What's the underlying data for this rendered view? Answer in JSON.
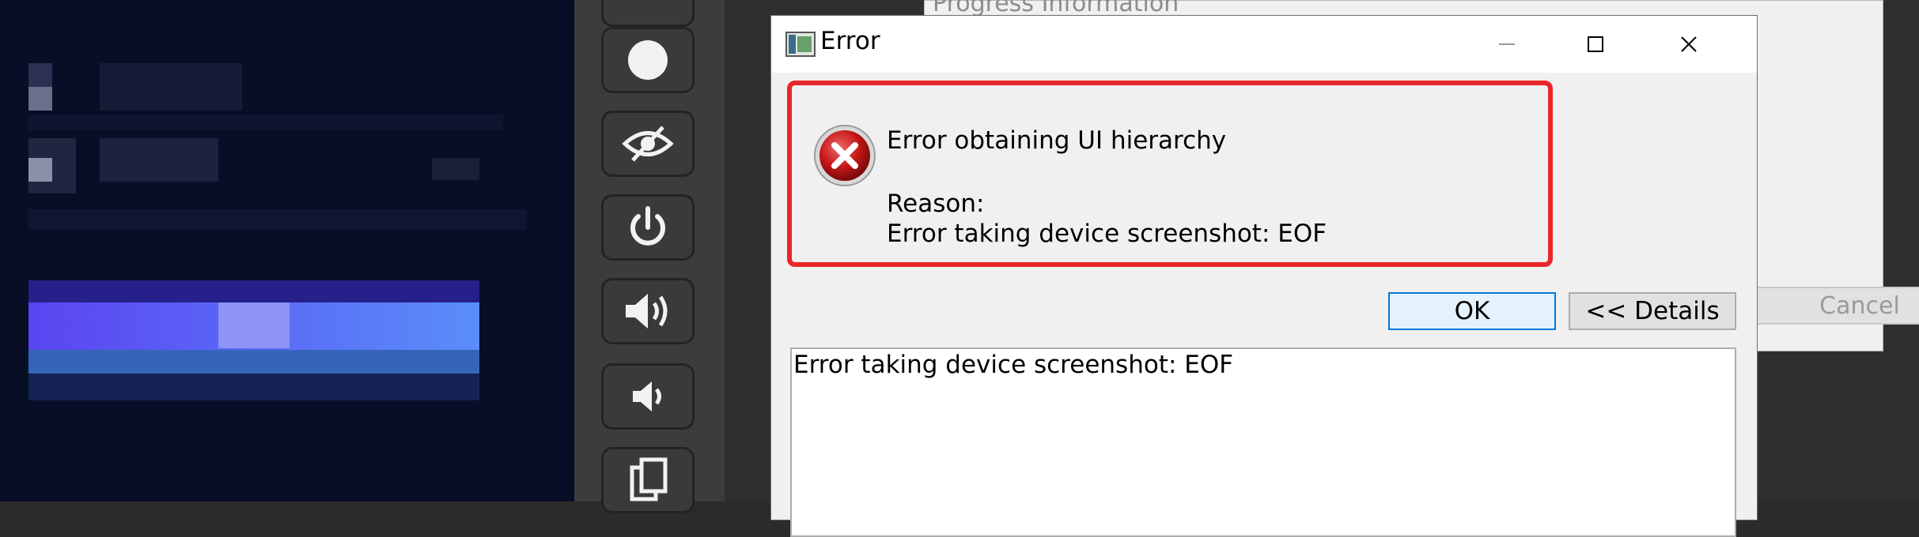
{
  "dialog": {
    "title": "Error",
    "controls": [
      "minimize-icon",
      "maximize-icon",
      "close-icon"
    ],
    "message": "Error obtaining UI hierarchy",
    "reason_label": "Reason:",
    "reason": "Error taking device screenshot: EOF",
    "ok_label": "OK",
    "details_label": "<< Details",
    "details_text": "Error taking device screenshot: EOF",
    "icon": "error-icon",
    "highlight_color": "#e8262a"
  },
  "background_window": {
    "title": "Progress Information",
    "cancel_label": "Cancel"
  },
  "emulator_toolbar": {
    "buttons": [
      "record-icon",
      "hide-icon",
      "power-icon",
      "volume-up-icon",
      "volume-down-icon",
      "copy-icon"
    ]
  }
}
